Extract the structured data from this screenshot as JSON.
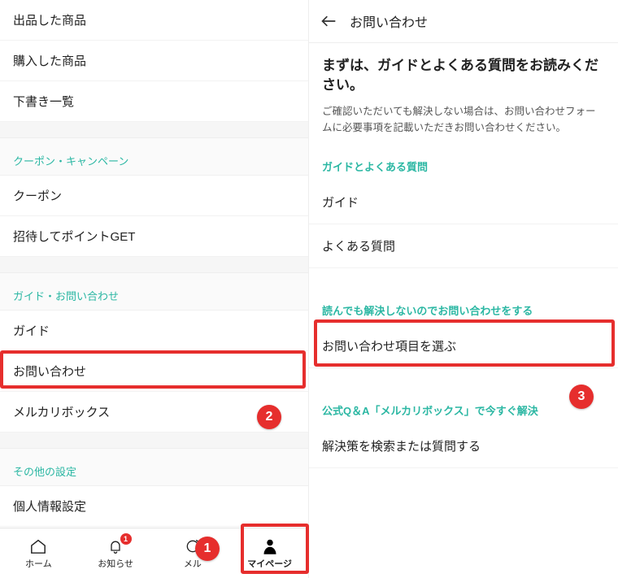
{
  "left": {
    "items_top": [
      "出品した商品",
      "購入した商品",
      "下書き一覧"
    ],
    "section_coupon": "クーポン・キャンペーン",
    "items_coupon": [
      "クーポン",
      "招待してポイントGET"
    ],
    "section_guide": "ガイド・お問い合わせ",
    "items_guide": [
      "ガイド",
      "お問い合わせ",
      "メルカリボックス"
    ],
    "section_other": "その他の設定",
    "items_other": [
      "個人情報設定"
    ]
  },
  "bottom_nav": {
    "home": "ホーム",
    "notice": "お知らせ",
    "notice_badge": "1",
    "mercari": "メル",
    "mypage": "マイページ"
  },
  "right": {
    "header_title": "お問い合わせ",
    "hero_title": "まずは、ガイドとよくある質問をお読みください。",
    "hero_body": "ご確認いただいても解決しない場合は、お問い合わせフォームに必要事項を記載いただきお問い合わせください。",
    "section_faq": "ガイドとよくある質問",
    "items_faq": [
      "ガイド",
      "よくある質問"
    ],
    "section_contact": "読んでも解決しないのでお問い合わせをする",
    "item_contact": "お問い合わせ項目を選ぶ",
    "section_qabox": "公式Q＆A「メルカリボックス」で今すぐ解決",
    "item_qabox": "解決策を検索または質問する"
  },
  "annotations": {
    "n1": "1",
    "n2": "2",
    "n3": "3"
  }
}
